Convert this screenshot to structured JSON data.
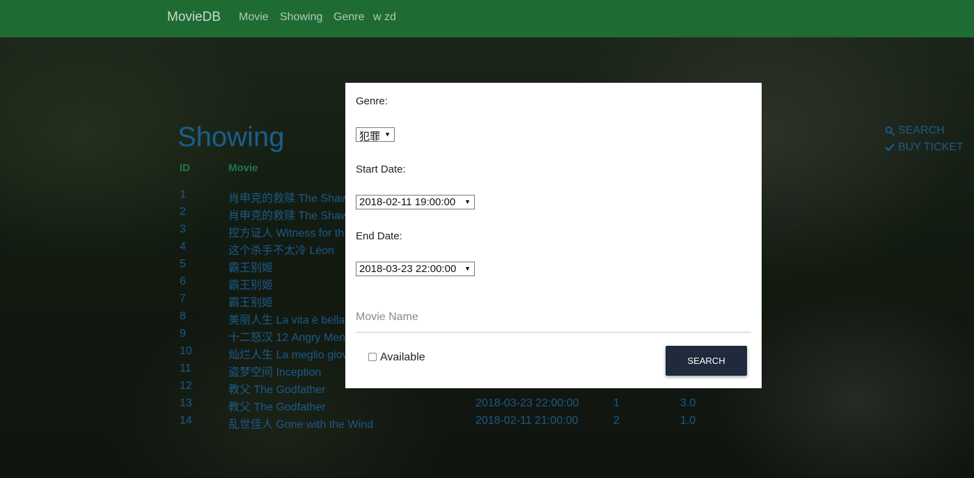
{
  "nav": {
    "brand": "MovieDB",
    "links": [
      "Movie",
      "Showing",
      "Genre",
      "w zd"
    ]
  },
  "page": {
    "title": "Showing",
    "headers": {
      "id": "ID",
      "movie": "Movie"
    }
  },
  "rows": [
    {
      "id": "1",
      "movie": "肖申克的救赎 The Shaw",
      "date": "",
      "hall": "",
      "price": ""
    },
    {
      "id": "2",
      "movie": "肖申克的救赎 The Shaw",
      "date": "",
      "hall": "",
      "price": ""
    },
    {
      "id": "3",
      "movie": "控方证人 Witness for th",
      "date": "",
      "hall": "",
      "price": ""
    },
    {
      "id": "4",
      "movie": "这个杀手不太冷 Léon",
      "date": "",
      "hall": "",
      "price": ""
    },
    {
      "id": "5",
      "movie": "霸王别姬",
      "date": "",
      "hall": "",
      "price": ""
    },
    {
      "id": "6",
      "movie": "霸王别姬",
      "date": "",
      "hall": "",
      "price": ""
    },
    {
      "id": "7",
      "movie": "霸王别姬",
      "date": "",
      "hall": "",
      "price": ""
    },
    {
      "id": "8",
      "movie": "美丽人生 La vita è bella",
      "date": "",
      "hall": "",
      "price": ""
    },
    {
      "id": "9",
      "movie": "十二怒汉 12 Angry Men",
      "date": "",
      "hall": "",
      "price": ""
    },
    {
      "id": "10",
      "movie": "灿烂人生 La meglio giov",
      "date": "",
      "hall": "",
      "price": ""
    },
    {
      "id": "11",
      "movie": "盗梦空间 Inception",
      "date": "",
      "hall": "",
      "price": ""
    },
    {
      "id": "12",
      "movie": "教父 The Godfather",
      "date": "",
      "hall": "",
      "price": ""
    },
    {
      "id": "13",
      "movie": "教父 The Godfather",
      "date": "2018-03-23 22:00:00",
      "hall": "1",
      "price": "3.0"
    },
    {
      "id": "14",
      "movie": "乱世佳人 Gone with the Wind",
      "date": "2018-02-11 21:00:00",
      "hall": "2",
      "price": "1.0"
    }
  ],
  "side": {
    "search": "SEARCH",
    "buy": "BUY TICKET"
  },
  "modal": {
    "genre_label": "Genre:",
    "genre_value": "犯罪",
    "start_label": "Start Date:",
    "start_value": "2018-02-11 19:00:00",
    "end_label": "End Date:",
    "end_value": "2018-03-23 22:00:00",
    "movie_placeholder": "Movie Name",
    "available_label": "Available",
    "search_button": "SEARCH"
  },
  "colors": {
    "navbar": "#1f6b34",
    "link": "#1c5a88",
    "header": "#1c7a45",
    "button": "#1f2a3c"
  }
}
